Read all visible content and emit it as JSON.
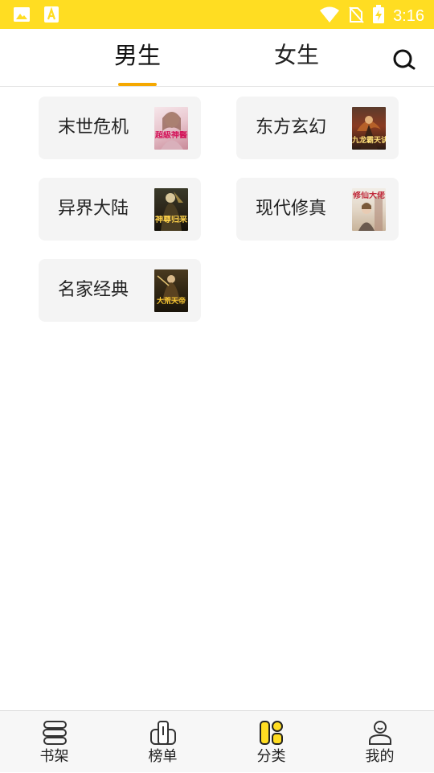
{
  "status_bar": {
    "time": "3:16",
    "left_icons": [
      "gallery-icon",
      "font-app-icon"
    ],
    "right_icons": [
      "wifi-icon",
      "no-sim-icon",
      "battery-charging-icon"
    ],
    "background": "#ffdd22"
  },
  "top_tabs": {
    "tabs": [
      {
        "label": "男生",
        "active": true
      },
      {
        "label": "女生",
        "active": false
      }
    ],
    "accent": "#f5a800",
    "search_icon": "search-icon"
  },
  "categories": [
    {
      "label": "末世危机",
      "cover_title": "超級神醫"
    },
    {
      "label": "东方玄幻",
      "cover_title": "九龙霸天诀"
    },
    {
      "label": "异界大陆",
      "cover_title": "神尊归来"
    },
    {
      "label": "现代修真",
      "cover_title": "修仙大佬"
    },
    {
      "label": "名家经典",
      "cover_title": "大荒天帝"
    }
  ],
  "bottom_nav": {
    "items": [
      {
        "label": "书架",
        "icon": "bookshelf-icon",
        "active": false
      },
      {
        "label": "榜单",
        "icon": "ranking-icon",
        "active": false
      },
      {
        "label": "分类",
        "icon": "category-icon",
        "active": true
      },
      {
        "label": "我的",
        "icon": "profile-icon",
        "active": false
      }
    ],
    "active_color": "#ffdd22"
  }
}
